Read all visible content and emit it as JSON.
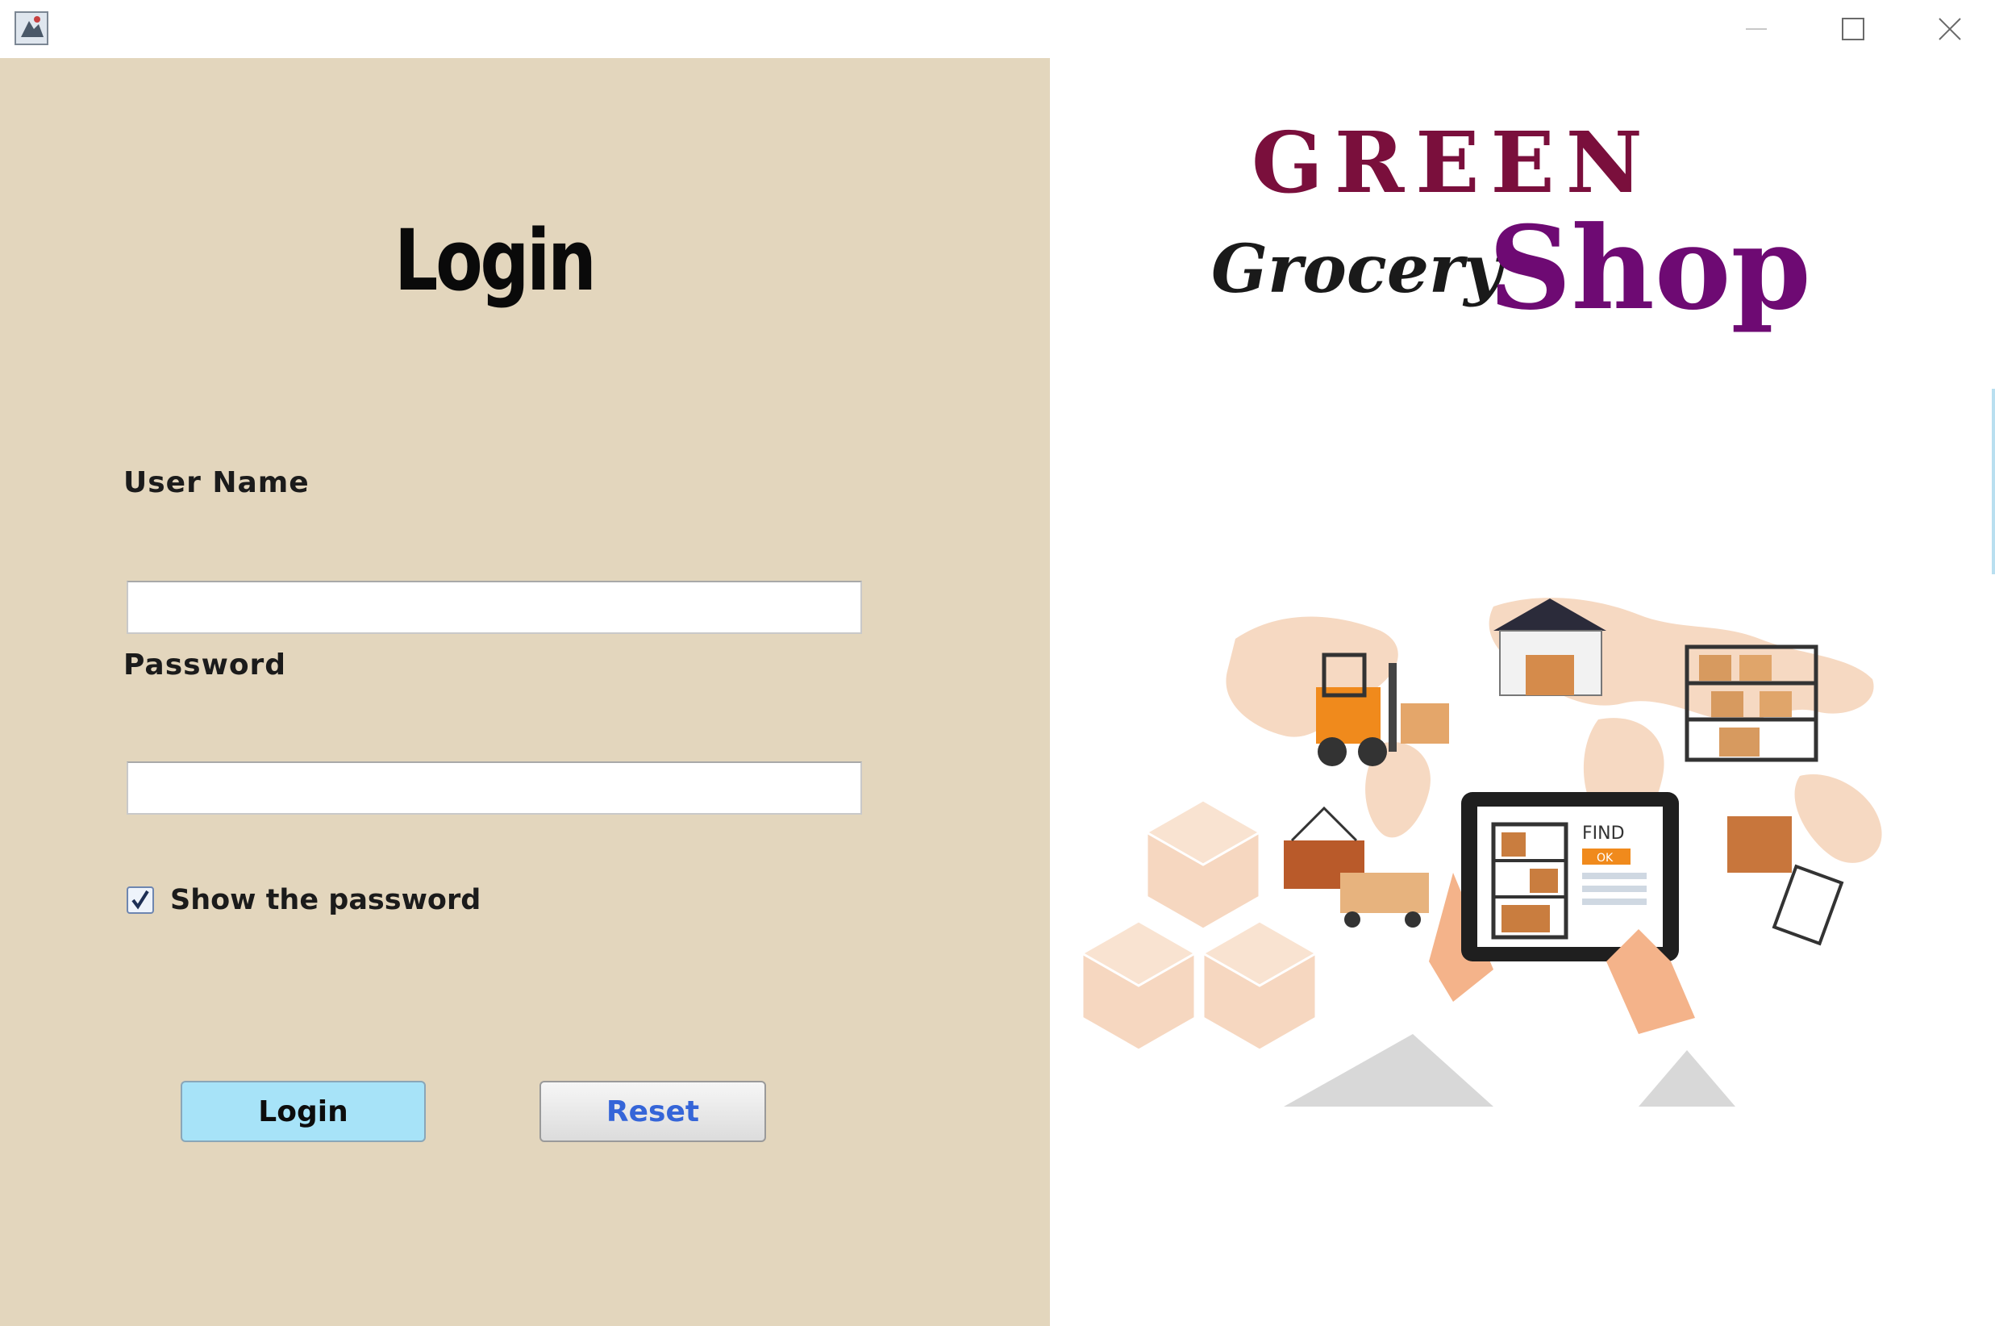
{
  "window": {
    "buttons": {
      "minimize_icon": "minimize-icon",
      "maximize_icon": "maximize-icon",
      "close_icon": "close-icon"
    }
  },
  "login_panel": {
    "title": "Login",
    "username_label": "User Name",
    "username_value": "",
    "password_label": "Password",
    "password_value": "",
    "show_password_label": "Show the password",
    "show_password_checked": true,
    "login_button": "Login",
    "reset_button": "Reset"
  },
  "branding": {
    "line1": "GREEN",
    "line2a": "Grocery",
    "line2b": "Shop"
  },
  "illustration": {
    "tablet_text": "FIND",
    "tablet_button": "OK"
  },
  "colors": {
    "panel_bg": "#e3d6bd",
    "brand_green_text": "#7a0f3c",
    "brand_shop_text": "#6e0a73",
    "login_button_bg": "#a7e3f8",
    "reset_text": "#3565d8"
  }
}
